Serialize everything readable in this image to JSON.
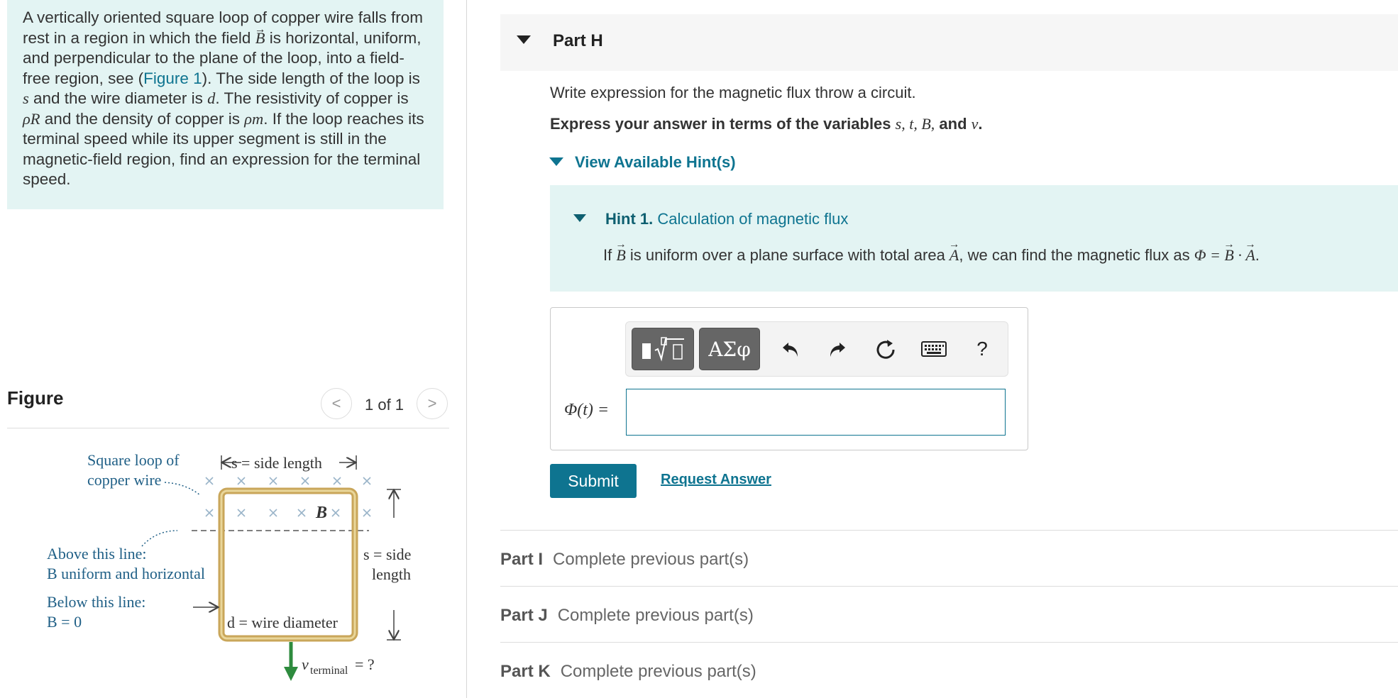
{
  "problem": {
    "t1": "A vertically oriented square loop of copper wire falls from rest in a region in which the field ",
    "B": "B",
    "t2": " is horizontal, uniform, and perpendicular to the plane of the loop, into a field-free region, see (",
    "fig_link": "Figure 1",
    "t3": "). The side length of the loop is ",
    "s": "s",
    "t4": " and the wire diameter is ",
    "d": "d",
    "t5": ". The resistivity of copper is ",
    "rhoR": "ρR",
    "t6": " and the density of copper is ",
    "rhom": "ρm",
    "t7": ". If the loop reaches its terminal speed while its upper segment is still in the magnetic-field region, find an expression for the terminal speed."
  },
  "figure": {
    "title": "Figure",
    "count": "1 of 1",
    "prev": "<",
    "next": ">",
    "labels": {
      "loop1": "Square loop of",
      "loop2": "copper wire",
      "side_top": "s = side length",
      "b_inside": "B",
      "above1": "Above this line:",
      "above2": "B uniform and horizontal",
      "below1": "Below this line:",
      "below2": "B = 0",
      "right1": "s = side",
      "right2": "length",
      "diam": "d = wire diameter",
      "vterm": "v",
      "vsub": "terminal",
      "veq": " = ?"
    }
  },
  "part_h": {
    "title": "Part H",
    "question": "Write expression for the magnetic flux throw a circuit.",
    "instruction_prefix": "Express your answer in terms of the variables ",
    "instruction_vars": "s, t, B,",
    "instruction_and": " and ",
    "instruction_last": "v",
    "instruction_end": ".",
    "hints_toggle": "View Available Hint(s)",
    "hint": {
      "label": "Hint 1.",
      "title": "Calculation of magnetic flux",
      "t1": "If ",
      "B": "B",
      "t2": " is uniform over a plane surface with total area ",
      "A": "A",
      "t3": ", we can find the magnetic flux as ",
      "formula": "Φ = ",
      "B2": "B",
      "dot": " · ",
      "A2": "A",
      "end": "."
    },
    "answer_label": "Φ(t) =",
    "answer_value": "",
    "toolbar": {
      "symbols": "ΑΣφ",
      "help": "?"
    },
    "submit": "Submit",
    "request_answer": "Request Answer"
  },
  "parts": [
    {
      "label": "Part I",
      "status": "Complete previous part(s)"
    },
    {
      "label": "Part J",
      "status": "Complete previous part(s)"
    },
    {
      "label": "Part K",
      "status": "Complete previous part(s)"
    }
  ],
  "colors": {
    "accent": "#0e7490",
    "hint_bg": "#e3f4f3",
    "loop_copper": "#c9a65a",
    "arrow_green": "#2e8b3e"
  }
}
